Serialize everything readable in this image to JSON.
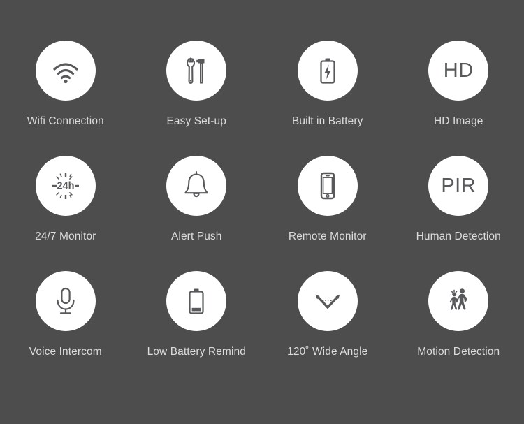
{
  "background_color": "#4d4d4d",
  "badge_color": "#ffffff",
  "label_color": "#dcdcdc",
  "icon_color": "#58595b",
  "grid": {
    "columns": 4,
    "rows": 3
  },
  "features": [
    {
      "label": "Wifi Connection",
      "icon": "wifi-icon",
      "icon_text": ""
    },
    {
      "label": "Easy Set-up",
      "icon": "wrench-hammer-icon",
      "icon_text": ""
    },
    {
      "label": "Built in Battery",
      "icon": "battery-charging-icon",
      "icon_text": ""
    },
    {
      "label": "HD Image",
      "icon": "hd-text-icon",
      "icon_text": "HD"
    },
    {
      "label": "24/7 Monitor",
      "icon": "twenty-four-hour-icon",
      "icon_text": "24h"
    },
    {
      "label": "Alert Push",
      "icon": "bell-icon",
      "icon_text": ""
    },
    {
      "label": "Remote Monitor",
      "icon": "smartphone-icon",
      "icon_text": ""
    },
    {
      "label": "Human Detection",
      "icon": "pir-text-icon",
      "icon_text": "PIR"
    },
    {
      "label": "Voice Intercom",
      "icon": "microphone-icon",
      "icon_text": ""
    },
    {
      "label": "Low Battery Remind",
      "icon": "battery-low-icon",
      "icon_text": ""
    },
    {
      "label": "120˚ Wide Angle",
      "icon": "wide-angle-icon",
      "icon_text": ""
    },
    {
      "label": "Motion Detection",
      "icon": "walking-people-icon",
      "icon_text": ""
    }
  ]
}
